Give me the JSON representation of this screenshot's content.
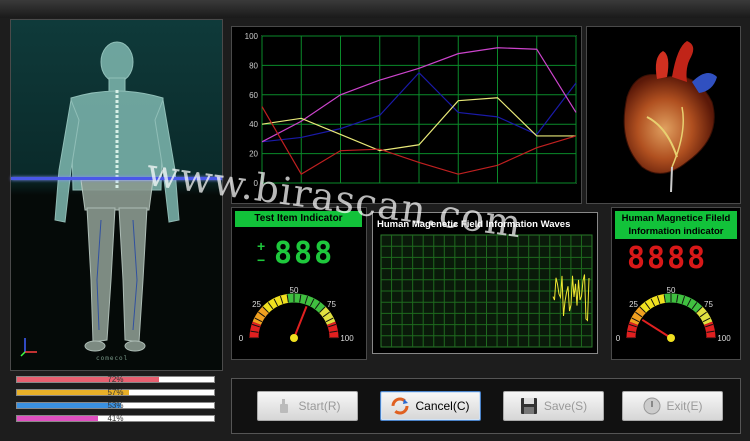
{
  "body_model": {
    "label": "comecol"
  },
  "line_chart": {
    "yticks": [
      "100",
      "80",
      "60",
      "40",
      "20",
      "0"
    ],
    "lines": [
      {
        "color": "#1a1aa8",
        "points": [
          [
            0,
            28
          ],
          [
            1,
            31
          ],
          [
            2,
            37
          ],
          [
            3,
            46
          ],
          [
            4,
            75
          ],
          [
            5,
            48
          ],
          [
            6,
            45
          ],
          [
            7,
            33
          ],
          [
            8,
            68
          ]
        ]
      },
      {
        "color": "#cc44cc",
        "points": [
          [
            0,
            28
          ],
          [
            1,
            42
          ],
          [
            2,
            60
          ],
          [
            3,
            70
          ],
          [
            4,
            78
          ],
          [
            5,
            88
          ],
          [
            6,
            92
          ],
          [
            7,
            91
          ],
          [
            8,
            48
          ]
        ]
      },
      {
        "color": "#e8e878",
        "points": [
          [
            0,
            40
          ],
          [
            1,
            44
          ],
          [
            2,
            33
          ],
          [
            3,
            22
          ],
          [
            4,
            26
          ],
          [
            5,
            56
          ],
          [
            6,
            58
          ],
          [
            7,
            32
          ],
          [
            8,
            32
          ]
        ]
      },
      {
        "color": "#c02020",
        "points": [
          [
            0,
            52
          ],
          [
            1,
            6
          ],
          [
            2,
            22
          ],
          [
            3,
            23
          ],
          [
            4,
            14
          ],
          [
            5,
            6
          ],
          [
            6,
            12
          ],
          [
            7,
            24
          ],
          [
            8,
            32
          ]
        ]
      }
    ]
  },
  "test_item": {
    "title": "Test Item Indicator",
    "plus": "+",
    "minus": "−",
    "digits": "888",
    "gauge": {
      "t0": "0",
      "t25": "25",
      "t50": "50",
      "t75": "75",
      "t100": "100"
    },
    "needle": 0.62
  },
  "waves": {
    "title": "Human Magenetic  Field Information Waves"
  },
  "magnetic": {
    "title": "Human Magnetice Fileld Information indicator",
    "digits": "8888",
    "gauge": {
      "t0": "0",
      "t25": "25",
      "t50": "50",
      "t75": "75",
      "t100": "100"
    },
    "needle": 0.18
  },
  "progress": [
    {
      "label": "72%",
      "value": 0.72,
      "color": "#e86070"
    },
    {
      "label": "57%",
      "value": 0.57,
      "color": "#e8b028"
    },
    {
      "label": "53%",
      "value": 0.53,
      "color": "#3a90e0"
    },
    {
      "label": "41%",
      "value": 0.41,
      "color": "#e050c0"
    }
  ],
  "buttons": {
    "start": "Start(R)",
    "cancel": "Cancel(C)",
    "save": "Save(S)",
    "exit": "Exit(E)"
  },
  "watermark": "www.birascan.com"
}
